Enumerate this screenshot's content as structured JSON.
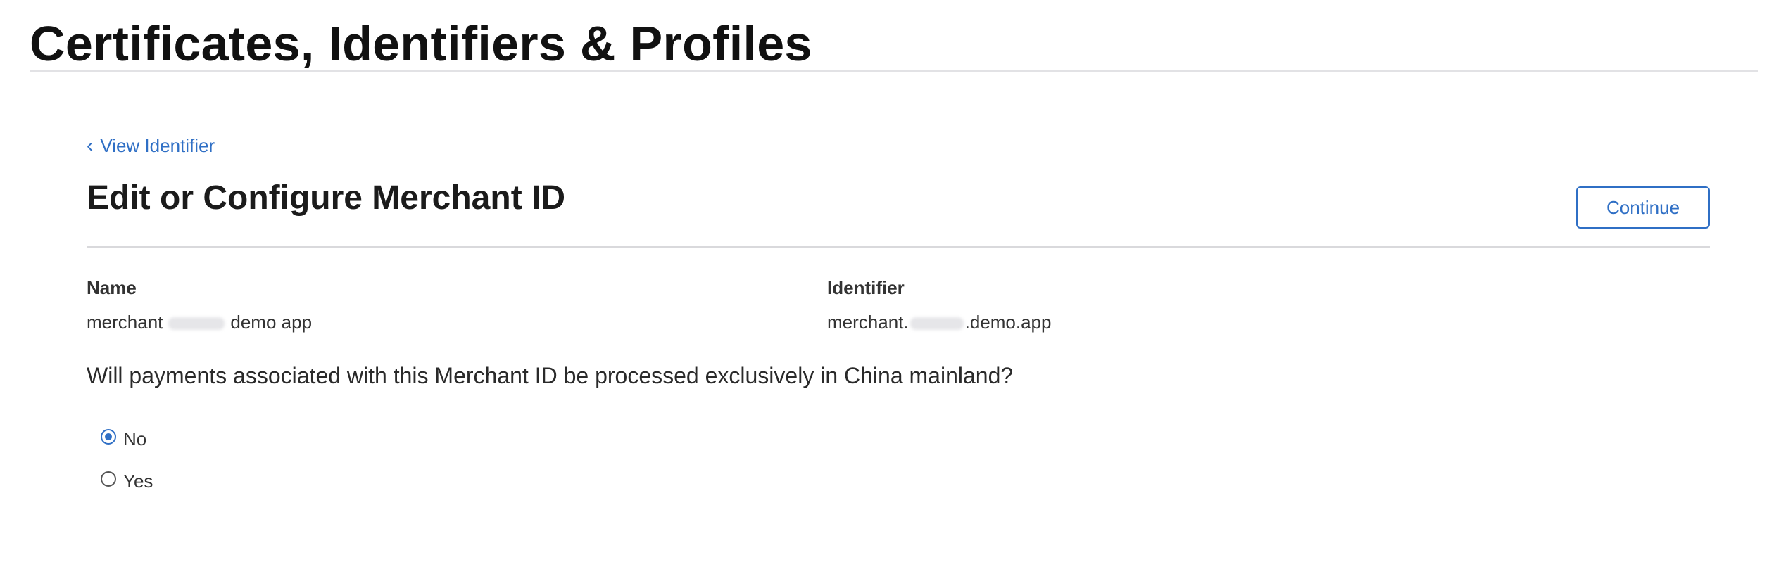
{
  "header": {
    "title": "Certificates, Identifiers & Profiles"
  },
  "nav": {
    "back_label": "View Identifier",
    "back_chevron": "‹"
  },
  "section": {
    "title": "Edit or Configure Merchant ID",
    "continue_label": "Continue"
  },
  "details": {
    "name_label": "Name",
    "name_value_prefix": "merchant",
    "name_value_suffix": "demo app",
    "identifier_label": "Identifier",
    "identifier_value_prefix": "merchant.",
    "identifier_value_suffix": ".demo.app"
  },
  "form": {
    "question": "Will payments associated with this Merchant ID be processed exclusively in China mainland?",
    "options": [
      {
        "label": "No",
        "selected": true
      },
      {
        "label": "Yes",
        "selected": false
      }
    ]
  },
  "colors": {
    "accent": "#2f6fc5",
    "divider": "#d9d9dc"
  }
}
